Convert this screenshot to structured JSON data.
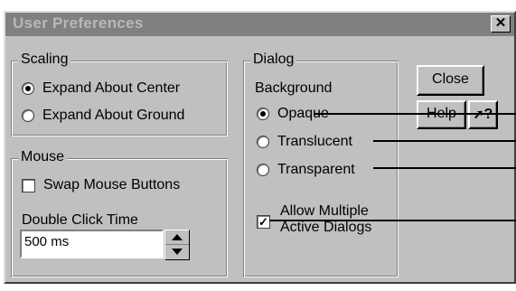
{
  "window": {
    "title": "User Preferences",
    "close_glyph": "✕"
  },
  "scaling": {
    "legend": "Scaling",
    "options": [
      {
        "label": "Expand About Center",
        "selected": true
      },
      {
        "label": "Expand About Ground",
        "selected": false
      }
    ]
  },
  "mouse": {
    "legend": "Mouse",
    "swap_label": "Swap Mouse Buttons",
    "swap_checked": false,
    "double_click_label": "Double Click Time",
    "double_click_value": "500 ms"
  },
  "dialog_group": {
    "legend": "Dialog",
    "background_label": "Background",
    "options": [
      {
        "label": "Opaque",
        "selected": true
      },
      {
        "label": "Translucent",
        "selected": false
      },
      {
        "label": "Transparent",
        "selected": false
      }
    ],
    "allow_multiple_line1": "Allow Multiple",
    "allow_multiple_line2": "Active Dialogs",
    "allow_multiple_checked": true
  },
  "buttons": {
    "close": "Close",
    "help": "Help",
    "whats_this": "?"
  }
}
